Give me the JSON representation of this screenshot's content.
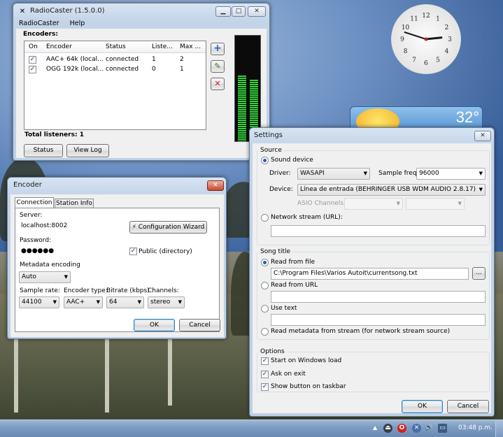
{
  "main_window": {
    "title": "RadioCaster (1.5.0.0)",
    "menu": [
      "RadioCaster",
      "Help"
    ],
    "encoders_label": "Encoders:",
    "columns": [
      "On",
      "Encoder",
      "Status",
      "Liste...",
      "Max ..."
    ],
    "rows": [
      {
        "on": "✓",
        "encoder": "AAC+ 64k (local...",
        "status": "connected",
        "listeners": "1",
        "max": "2"
      },
      {
        "on": "✓",
        "encoder": "OGG 192k (local...",
        "status": "connected",
        "listeners": "0",
        "max": "1"
      }
    ],
    "total_listeners": "Total listeners: 1",
    "status_button": "Status",
    "viewlog_button": "View Log",
    "add_symbol": "+",
    "remove_symbol": "✕"
  },
  "clock": {
    "hours": 2,
    "minutes": 48,
    "numbers": [
      "12",
      "1",
      "2",
      "3",
      "4",
      "5",
      "6",
      "7",
      "8",
      "9",
      "10",
      "11"
    ]
  },
  "weather": {
    "temperature": "32°"
  },
  "encoder_dialog": {
    "title": "Encoder",
    "tabs": [
      "Connection",
      "Station Info"
    ],
    "server_label": "Server:",
    "server_value": "localhost:8002",
    "config_wizard": "Configuration Wizard",
    "password_label": "Password:",
    "password_value": "●●●●●●",
    "public_label": "Public (directory)",
    "metadata_label": "Metadata encoding",
    "metadata_value": "Auto",
    "sample_rate_label": "Sample rate:",
    "sample_rate_value": "44100",
    "encoder_type_label": "Encoder type:",
    "encoder_type_value": "AAC+",
    "bitrate_label": "Bitrate (kbps)",
    "bitrate_value": "64",
    "channels_label": "Channels:",
    "channels_value": "stereo",
    "ok": "OK",
    "cancel": "Cancel"
  },
  "settings_dialog": {
    "title": "Settings",
    "source_group": "Source",
    "sound_device": "Sound device",
    "driver_label": "Driver:",
    "driver_value": "WASAPI",
    "sample_freq_label": "Sample freq:",
    "sample_freq_value": "96000",
    "device_label": "Device:",
    "device_value": "Línea de entrada (BEHRINGER USB WDM AUDIO 2.8.17)",
    "asio_label": "ASIO Channels:",
    "network_stream": "Network stream (URL):",
    "song_title_group": "Song title",
    "read_from_file": "Read from file",
    "file_path": "C:\\Program Files\\Varios Autoit\\currentsong.txt",
    "browse": "...",
    "read_from_url": "Read from URL",
    "use_text": "Use text",
    "read_metadata": "Read metadata from stream (for network stream source)",
    "options_group": "Options",
    "start_on_load": "Start on Windows load",
    "ask_on_exit": "Ask on exit",
    "show_taskbar": "Show button on taskbar",
    "ok": "OK",
    "cancel": "Cancel"
  },
  "taskbar": {
    "time": "03:48 p.m."
  },
  "vu_levels": {
    "left": 0.62,
    "right": 0.58
  }
}
